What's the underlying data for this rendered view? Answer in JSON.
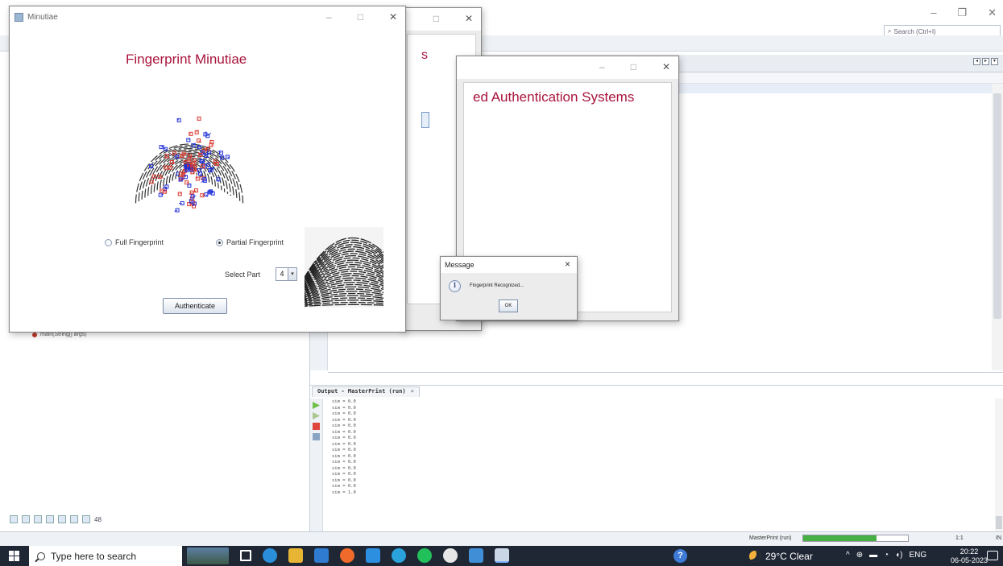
{
  "ide": {
    "search_placeholder": "Search (Ctrl+I)",
    "nav_item": "main(String[] args)",
    "left_tools_count": "48",
    "output_tab_title": "Output - MasterPrint (run)",
    "output_tab_close": "×",
    "output_lines": [
      "sim = 0.0",
      "sim = 0.0",
      "sim = 0.0",
      "sim = 0.0",
      "sim = 0.0",
      "sim = 0.0",
      "sim = 0.0",
      "sim = 0.0",
      "sim = 0.0",
      "sim = 0.0",
      "sim = 0.0",
      "sim = 0.0",
      "sim = 0.0",
      "sim = 0.0",
      "sim = 0.0",
      "sim = 1.0"
    ],
    "status_process": "MasterPrint (run)",
    "status_progress_fraction": 0.7,
    "status_position": "1:1",
    "status_mode": "IN"
  },
  "windows": {
    "minutiae": {
      "title": "Minutiae",
      "heading": "Fingerprint Minutiae",
      "radio_full": "Full Fingerprint",
      "radio_partial": "Partial Fingerprint",
      "selected_radio": "partial",
      "select_label": "Select Part",
      "select_value": "4",
      "authenticate_label": "Authenticate"
    },
    "back": {
      "heading_fragment": "s"
    },
    "middle": {
      "heading_fragment": "ed Authentication Systems"
    },
    "message": {
      "title": "Message",
      "text": "Fingerprint Recognized...",
      "ok_label": "OK",
      "close_glyph": "×"
    }
  },
  "taskbar": {
    "search_placeholder": "Type here to search",
    "weather": "29°C  Clear",
    "tray_lang": "ENG",
    "time": "20:22",
    "date": "06-05-2023"
  },
  "colors": {
    "heading": "#a8143c",
    "minutiae_blue": "#1f2fd8",
    "minutiae_red": "#d9342b",
    "taskbar": "#1f2735"
  }
}
